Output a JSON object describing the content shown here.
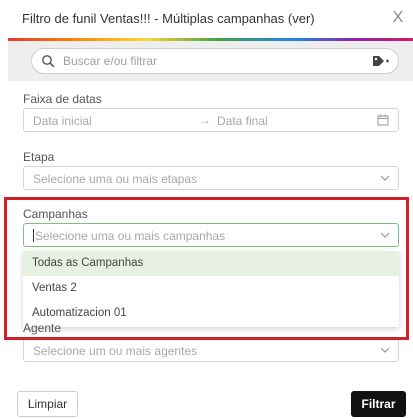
{
  "header": {
    "title": "Filtro de funil Ventas!!! - Múltiplas campanhas (ver)",
    "close_glyph": "X"
  },
  "search": {
    "placeholder": "Buscar e/ou filtrar",
    "icon": "search-icon",
    "tag_icon": "tag-plus-icon"
  },
  "date_range": {
    "label": "Faixa de datas",
    "start_placeholder": "Data inicial",
    "end_placeholder": "Data final",
    "arrow": "→"
  },
  "stage": {
    "label": "Etapa",
    "placeholder": "Selecione uma ou mais etapas"
  },
  "campaigns": {
    "label": "Campanhas",
    "placeholder": "Selecione uma ou mais campanhas",
    "options": [
      {
        "label": "Todas as Campanhas",
        "selected": true
      },
      {
        "label": "Ventas 2",
        "selected": false
      },
      {
        "label": "Automatizacion 01",
        "selected": false
      }
    ]
  },
  "agent": {
    "label": "Agente",
    "placeholder": "Selecione um ou mais agentes"
  },
  "footer": {
    "clear_label": "Limpiar",
    "filter_label": "Filtrar"
  },
  "colors": {
    "highlight_border": "#d0202a",
    "active_border": "#7cc27c",
    "selected_option_bg": "#e8f0e2",
    "primary_button": "#111111"
  }
}
